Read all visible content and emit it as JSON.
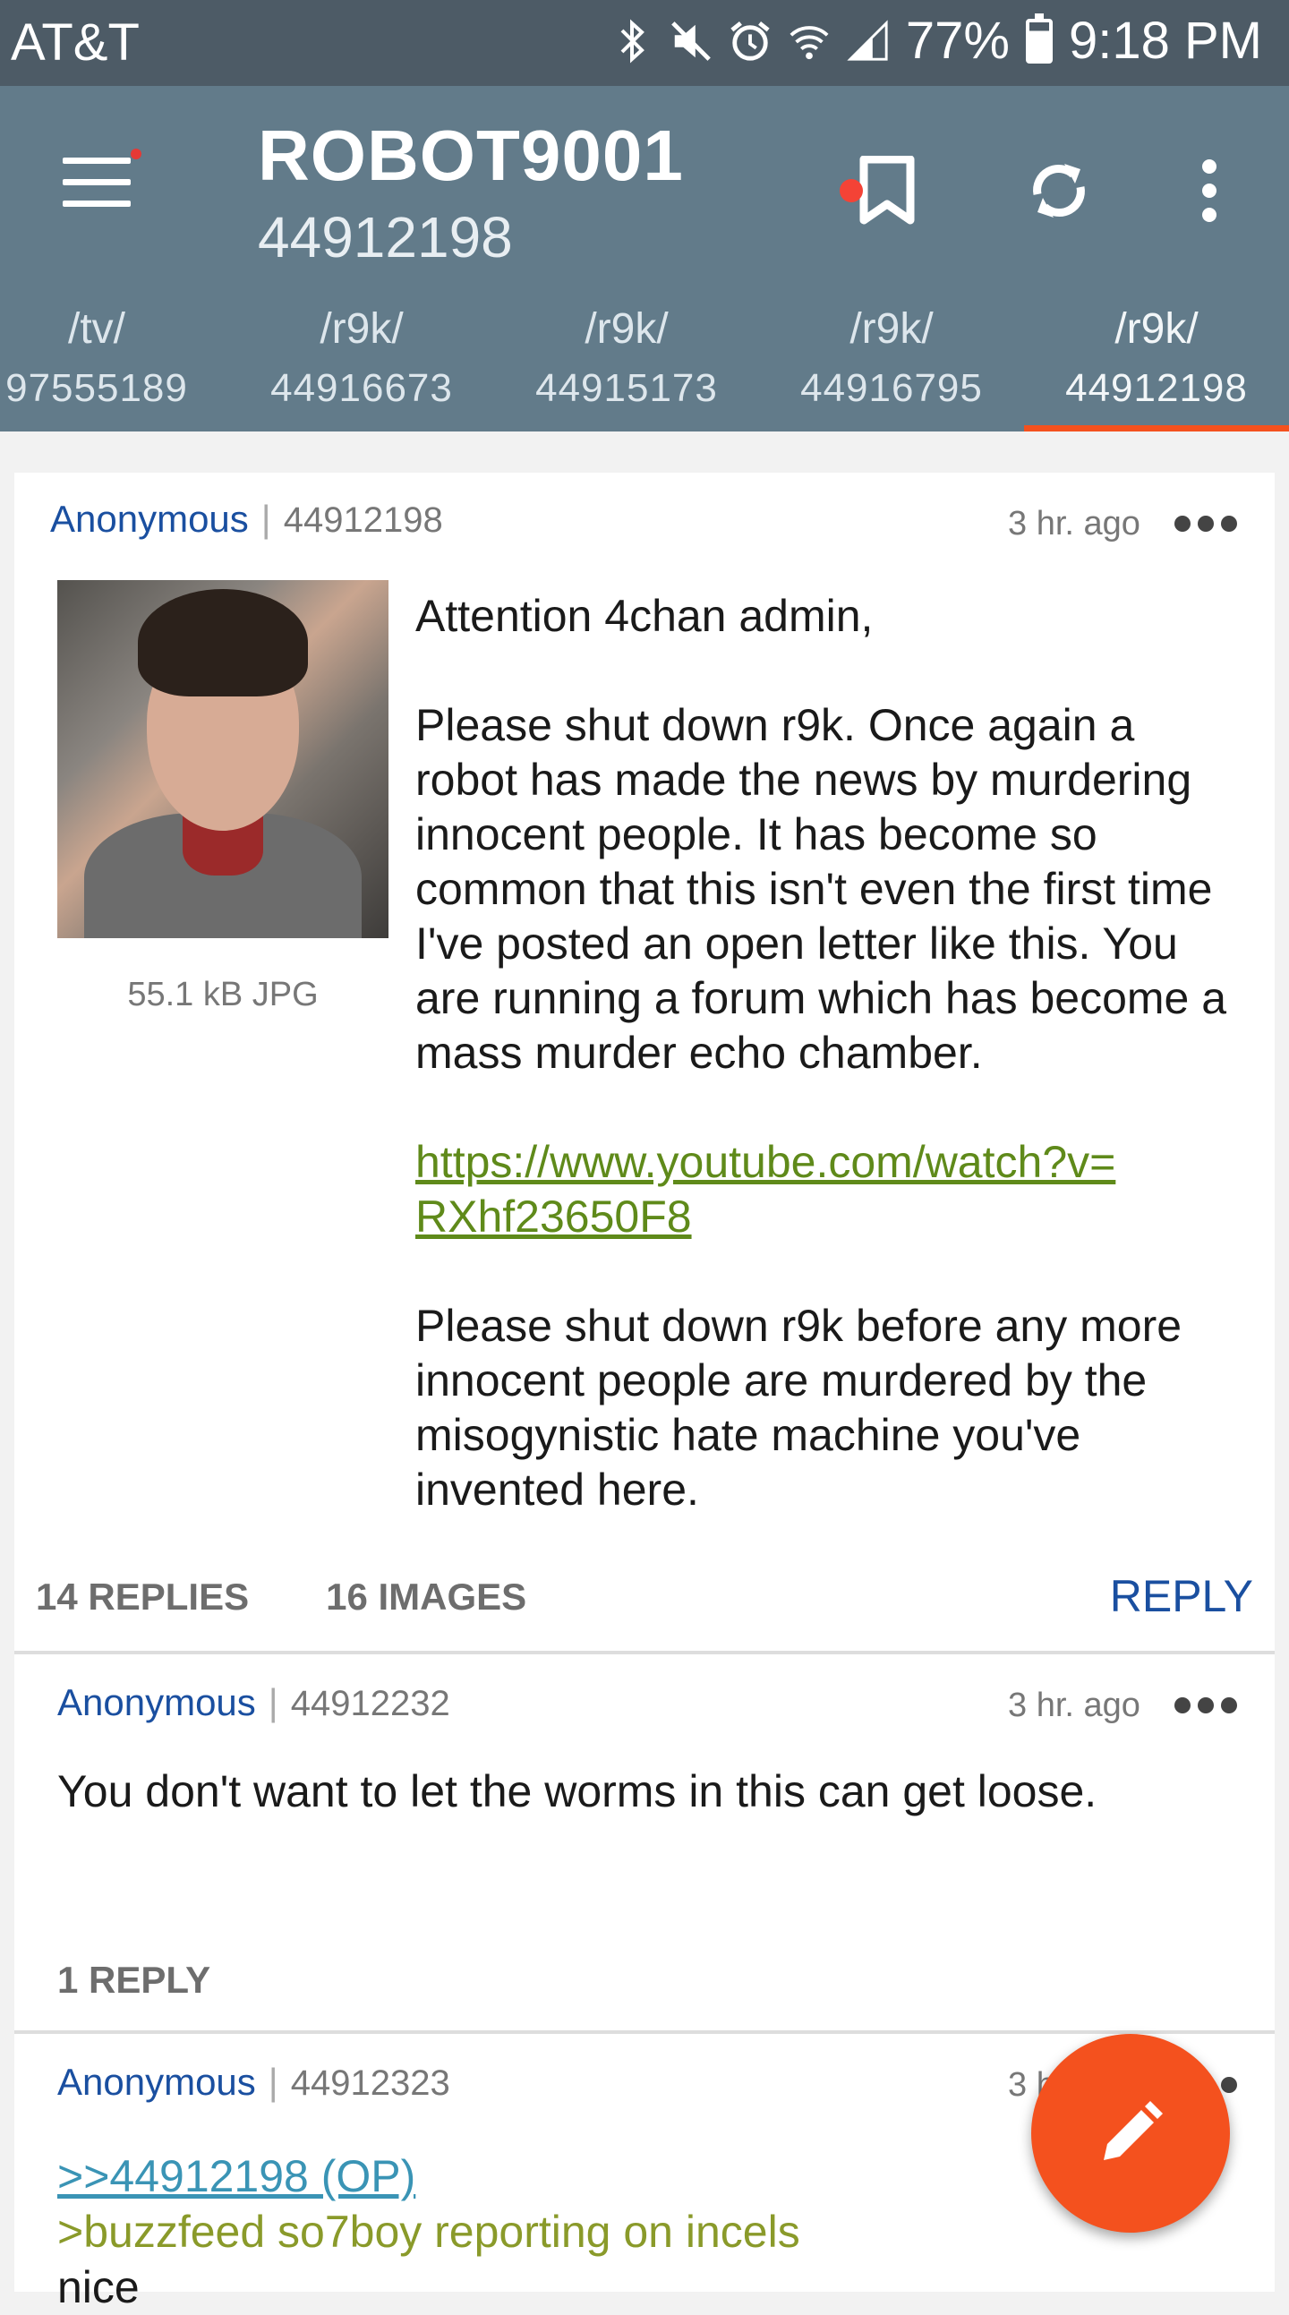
{
  "status_bar": {
    "carrier": "AT&T",
    "battery": "77%",
    "time": "9:18 PM",
    "icons": [
      "bluetooth-icon",
      "mute-icon",
      "alarm-icon",
      "wifi-icon",
      "signal-icon",
      "battery-icon"
    ]
  },
  "app_bar": {
    "title": "ROBOT9001",
    "subtitle": "44912198",
    "actions": [
      "bookmark-icon",
      "refresh-icon",
      "more-vert-icon"
    ],
    "colors": {
      "background": "#627b8a",
      "accent": "#f4511e"
    }
  },
  "tabs": [
    {
      "board": "/tv/",
      "thread": "97555189"
    },
    {
      "board": "/r9k/",
      "thread": "44916673"
    },
    {
      "board": "/r9k/",
      "thread": "44915173"
    },
    {
      "board": "/r9k/",
      "thread": "44916795",
      "unread": true
    },
    {
      "board": "/r9k/",
      "thread": "44912198",
      "active": true
    }
  ],
  "op": {
    "author": "Anonymous",
    "post_no": "44912198",
    "time": "3 hr. ago",
    "file_info": "55.1 kB JPG",
    "paragraphs": [
      "Attention 4chan admin,",
      "Please shut down r9k. Once again a robot has made the news by murdering innocent people. It has become so common that this isn't even the first time I've posted an open letter like this. You are running a forum which has become a mass murder echo chamber."
    ],
    "link_line1": "https://www.youtube.com/watch?v=",
    "link_line2": "RXhf23650F8",
    "closing": "Please shut down r9k before any more innocent people are murdered by the misogynistic hate machine you've invented here.",
    "replies": "14 REPLIES",
    "images": "16 IMAGES",
    "reply_label": "REPLY"
  },
  "reply1": {
    "author": "Anonymous",
    "post_no": "44912232",
    "time": "3 hr. ago",
    "text": "You don't want to let the worms in this can get loose.",
    "replies": "1 REPLY"
  },
  "reply2": {
    "author": "Anonymous",
    "post_no": "44912323",
    "time": "3 h",
    "quote_link": ">>44912198 (OP)",
    "greentext": ">buzzfeed so7boy reporting on incels",
    "text": "nice"
  },
  "fab_icon": "pencil-icon"
}
